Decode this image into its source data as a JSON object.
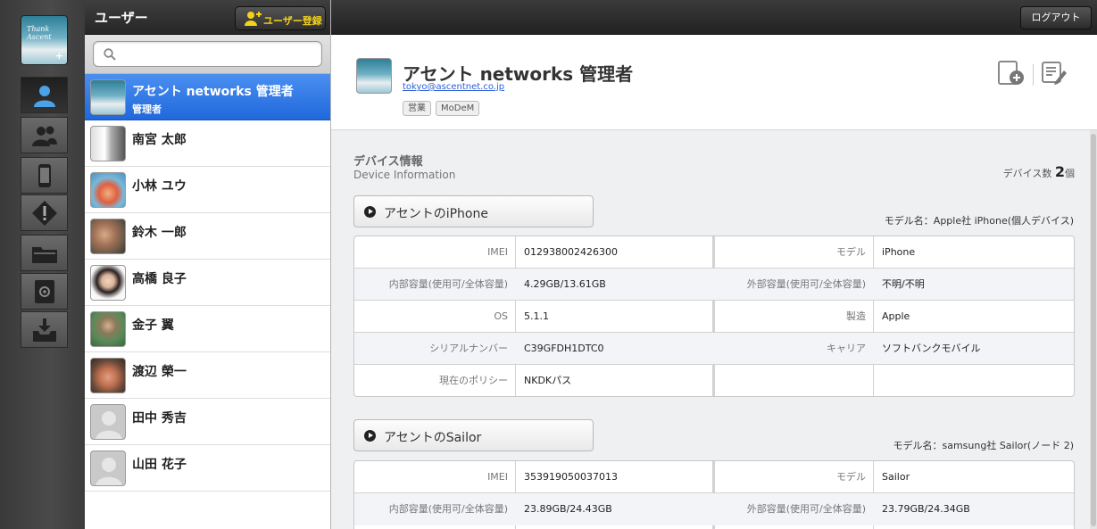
{
  "users_panel": {
    "title": "ユーザー",
    "register_label": "ユーザー登録",
    "search_placeholder": "",
    "users": [
      {
        "name": "アセント networks 管理者",
        "role": "管理者",
        "selected": true
      },
      {
        "name": "南宮 太郎",
        "role": ""
      },
      {
        "name": "小林 ユウ",
        "role": ""
      },
      {
        "name": "鈴木 一郎",
        "role": ""
      },
      {
        "name": "高橋 良子",
        "role": ""
      },
      {
        "name": "金子 翼",
        "role": ""
      },
      {
        "name": "渡辺 榮一",
        "role": ""
      },
      {
        "name": "田中 秀吉",
        "role": ""
      },
      {
        "name": "山田 花子",
        "role": ""
      }
    ]
  },
  "rail": {
    "logo_text": "Thank Ascent",
    "items": [
      "user-icon",
      "users-group-icon",
      "device-icon",
      "warning-icon",
      "folder-icon",
      "address-book-icon",
      "download-tray-icon"
    ]
  },
  "topbar": {
    "logout_label": "ログアウト"
  },
  "profile": {
    "name": "アセント networks 管理者",
    "email": "tokyo@ascentnet.co.jp",
    "tags": [
      "営業",
      "MoDeM"
    ]
  },
  "device_section": {
    "title": "デバイス情報",
    "subtitle": "Device Information",
    "count_label": "デバイス数",
    "count_value": "2",
    "count_unit": "個",
    "devices": [
      {
        "button_label": "アセントのiPhone",
        "model_line": "モデル名：Apple社 iPhone(個人デバイス)",
        "rows": [
          {
            "l1": "IMEI",
            "v1": "012938002426300",
            "l2": "モデル",
            "v2": "iPhone"
          },
          {
            "l1": "内部容量(使用可/全体容量)",
            "v1": "4.29GB/13.61GB",
            "l2": "外部容量(使用可/全体容量)",
            "v2": "不明/不明"
          },
          {
            "l1": "OS",
            "v1": "5.1.1",
            "l2": "製造",
            "v2": "Apple"
          },
          {
            "l1": "シリアルナンバー",
            "v1": "C39GFDH1DTC0",
            "l2": "キャリア",
            "v2": "ソフトバンクモバイル"
          },
          {
            "l1": "現在のポリシー",
            "v1": "NKDKパス",
            "l2": "",
            "v2": ""
          }
        ]
      },
      {
        "button_label": "アセントのSailor",
        "model_line": "モデル名：samsung社 Sailor(ノード 2)",
        "rows": [
          {
            "l1": "IMEI",
            "v1": "353919050037013",
            "l2": "モデル",
            "v2": "Sailor"
          },
          {
            "l1": "内部容量(使用可/全体容量)",
            "v1": "23.89GB/24.43GB",
            "l2": "外部容量(使用可/全体容量)",
            "v2": "23.79GB/24.34GB"
          }
        ]
      }
    ]
  }
}
